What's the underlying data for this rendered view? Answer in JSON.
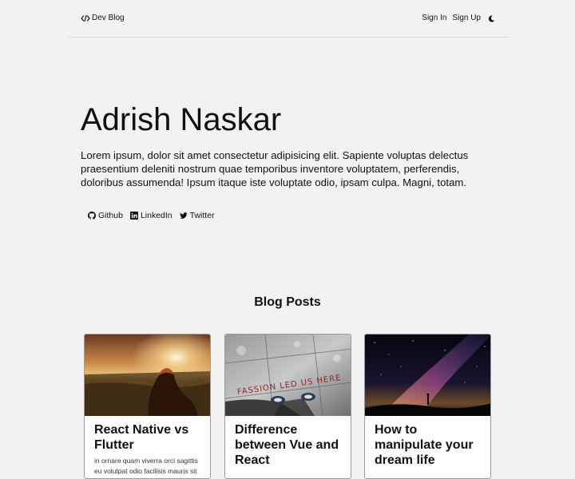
{
  "navbar": {
    "brand": "Dev Blog",
    "sign_in": "Sign In",
    "sign_up": "Sign Up",
    "theme_icon": "moon-icon"
  },
  "hero": {
    "name": "Adrish Naskar",
    "bio": "Lorem ipsum, dolor sit amet consectetur adipisicing elit. Sapiente voluptas delectus praesentium deleniti nostrum quae temporibus inventore voluptatem, perferendis, doloribus assumenda! Ipsum itaque iste voluptate odio, ipsam culpa. Magni, totam.",
    "social": [
      {
        "label": "Github",
        "icon": "github-icon"
      },
      {
        "label": "LinkedIn",
        "icon": "linkedin-icon"
      },
      {
        "label": "Twitter",
        "icon": "twitter-icon"
      }
    ]
  },
  "blog": {
    "section_title": "Blog Posts",
    "posts": [
      {
        "title": "React Native vs Flutter",
        "excerpt": "in ornare quam viverra orci sagittis eu volutpat odio facilisis mauris sit",
        "image": "sunset-field-photo"
      },
      {
        "title": "Difference between Vue and React",
        "excerpt": "",
        "image": "fashion-led-us-here-photo",
        "image_text": "FASSION LED US HERE"
      },
      {
        "title": "How to manipulate your dream life",
        "excerpt": "",
        "image": "milky-way-night-sky-photo"
      }
    ]
  },
  "colors": {
    "background": "#f2f2f3",
    "text": "#111111",
    "card_border": "#9a9a9e"
  }
}
